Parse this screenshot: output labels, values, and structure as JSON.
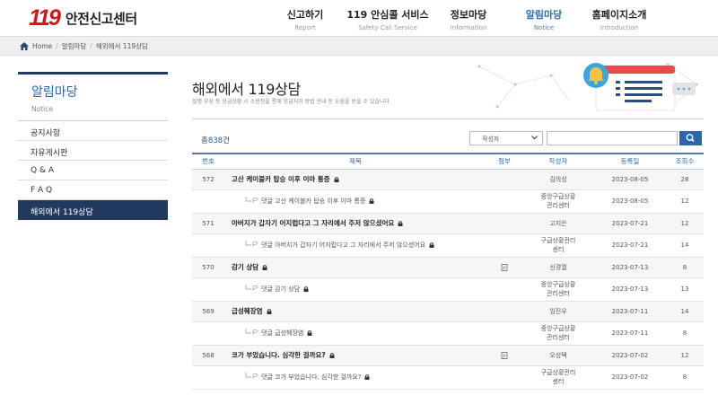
{
  "header": {
    "logo_number": "119",
    "logo_text": "안전신고센터",
    "nav": [
      {
        "label": "신고하기",
        "sub": "Report",
        "active": false
      },
      {
        "label": "119 안심콜 서비스",
        "sub": "Safety Call Service",
        "active": false
      },
      {
        "label": "정보마당",
        "sub": "Information",
        "active": false
      },
      {
        "label": "알림마당",
        "sub": "Notice",
        "active": true
      },
      {
        "label": "홈페이지소개",
        "sub": "Introduction",
        "active": false
      }
    ]
  },
  "breadcrumb": {
    "home": "Home",
    "level1": "알림마당",
    "level2": "해외에서 119상담"
  },
  "sidebar": {
    "title": "알림마당",
    "subtitle": "Notice",
    "items": [
      {
        "label": "공지사항"
      },
      {
        "label": "자유게시판"
      },
      {
        "label": "Q & A"
      },
      {
        "label": "F A Q"
      },
      {
        "label": "해외에서 119상담"
      }
    ]
  },
  "page": {
    "title": "해외에서 119상담",
    "description": "질병·부상 등 응급상황 시 소방청을 통해 응급처치 방법 안내 등 도움을 받을 수 있습니다."
  },
  "list": {
    "total_prefix": "총",
    "total_count": "838",
    "total_suffix": "건",
    "search_field": "작성자",
    "search_value": "",
    "columns": {
      "no": "번호",
      "title": "제목",
      "attach": "첨부",
      "author": "작성자",
      "date": "등록일",
      "views": "조회수"
    },
    "reply_prefix": "댓글",
    "rows": [
      {
        "type": "post",
        "no": "572",
        "title": "고산 케이블카 탑승 이후 이마 통증",
        "attach": false,
        "author1": "김의성",
        "author2": "",
        "date": "2023-08-05",
        "views": "28"
      },
      {
        "type": "reply",
        "no": "",
        "title": "고산 케이블카 탑승 이후 이마 통증",
        "attach": false,
        "author1": "중앙구급상황",
        "author2": "관리센터",
        "date": "2023-08-05",
        "views": "12"
      },
      {
        "type": "post",
        "no": "571",
        "title": "아버지가 갑자기 어지럽다고 그 자리에서 주저 앉으셨어요",
        "attach": false,
        "author1": "고지은",
        "author2": "",
        "date": "2023-07-21",
        "views": "12"
      },
      {
        "type": "reply",
        "no": "",
        "title": "아버지가 갑자기 어지럽다고 그 자리에서 주저 앉으셨어요",
        "attach": false,
        "author1": "구급상황관리",
        "author2": "센터",
        "date": "2023-07-21",
        "views": "14"
      },
      {
        "type": "post",
        "no": "570",
        "title": "감기 상담",
        "attach": true,
        "author1": "신경열",
        "author2": "",
        "date": "2023-07-13",
        "views": "8"
      },
      {
        "type": "reply",
        "no": "",
        "title": "감기 상담",
        "attach": false,
        "author1": "중앙구급상황",
        "author2": "관리센터",
        "date": "2023-07-13",
        "views": "13"
      },
      {
        "type": "post",
        "no": "569",
        "title": "급성췌장염",
        "attach": false,
        "author1": "임진우",
        "author2": "",
        "date": "2023-07-11",
        "views": "14"
      },
      {
        "type": "reply",
        "no": "",
        "title": "급성췌장염",
        "attach": false,
        "author1": "중앙구급상황",
        "author2": "관리센터",
        "date": "2023-07-11",
        "views": "8"
      },
      {
        "type": "post",
        "no": "568",
        "title": "코가 부었습니다. 심각한 걸까요?",
        "attach": true,
        "author1": "오성택",
        "author2": "",
        "date": "2023-07-02",
        "views": "12"
      },
      {
        "type": "reply",
        "no": "",
        "title": "코가 부었습니다. 심각한 걸까요?",
        "attach": false,
        "author1": "구급상황관리",
        "author2": "센터",
        "date": "2023-07-02",
        "views": "8"
      }
    ]
  },
  "colors": {
    "brand_red": "#d7141a",
    "primary_blue": "#2a66ad",
    "sidebar_navy": "#213a5e"
  },
  "icons": [
    "home-icon",
    "search-icon",
    "lock-icon",
    "reply-arrow-icon",
    "file-icon",
    "bell-icon",
    "chevron-down-icon"
  ]
}
